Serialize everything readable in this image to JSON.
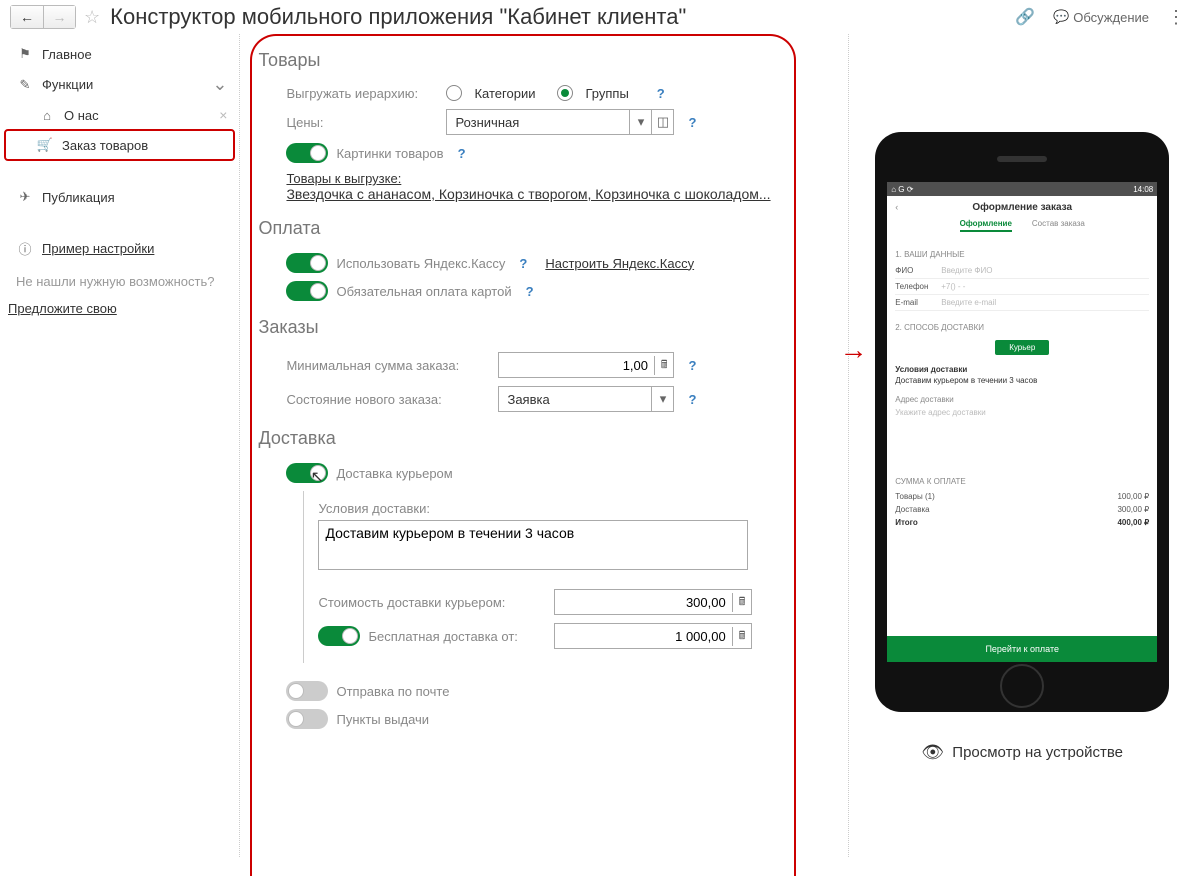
{
  "header": {
    "title": "Конструктор мобильного приложения \"Кабинет клиента\"",
    "discuss": "Обсуждение"
  },
  "sidebar": {
    "main": "Главное",
    "functions": "Функции",
    "about": "О нас",
    "order_goods": "Заказ товаров",
    "publication": "Публикация",
    "example": "Пример настройки",
    "note1": "Не нашли нужную возможность?",
    "suggest": "Предложите свою"
  },
  "goods": {
    "title": "Товары",
    "hierarchy_label": "Выгружать иерархию:",
    "opt_categories": "Категории",
    "opt_groups": "Группы",
    "prices_label": "Цены:",
    "price_value": "Розничная",
    "pictures_label": "Картинки товаров",
    "export_label": "Товары к выгрузке:",
    "export_list": "Звездочка с ананасом, Корзиночка с творогом, Корзиночка с шоколадом..."
  },
  "payment": {
    "title": "Оплата",
    "yandex_label": "Использовать Яндекс.Кассу",
    "yandex_setup": "Настроить Яндекс.Кассу",
    "card_label": "Обязательная оплата картой"
  },
  "orders": {
    "title": "Заказы",
    "min_sum_label": "Минимальная сумма заказа:",
    "min_sum_value": "1,00",
    "state_label": "Состояние нового заказа:",
    "state_value": "Заявка"
  },
  "delivery": {
    "title": "Доставка",
    "courier_label": "Доставка курьером",
    "conditions_label": "Условия доставки:",
    "conditions_value": "Доставим курьером в течении 3 часов",
    "cost_label": "Стоимость доставки курьером:",
    "cost_value": "300,00",
    "free_label": "Бесплатная доставка от:",
    "free_value": "1 000,00",
    "post_label": "Отправка по почте",
    "pickup_label": "Пункты выдачи"
  },
  "phone": {
    "status_left": "⌂ G ⟳",
    "status_right": "14:08",
    "title": "Оформление заказа",
    "tab1": "Оформление",
    "tab2": "Состав заказа",
    "sect1": "1. ВАШИ ДАННЫЕ",
    "fio_k": "ФИО",
    "fio_ph": "Введите ФИО",
    "phone_k": "Телефон",
    "phone_ph": "+7() - -",
    "email_k": "E-mail",
    "email_ph": "Введите e-mail",
    "sect2": "2. СПОСОБ ДОСТАВКИ",
    "courier_btn": "Курьер",
    "cond_head": "Условия доставки",
    "cond_text": "Доставим курьером в течении 3 часов",
    "addr_head": "Адрес доставки",
    "addr_ph": "Укажите адрес доставки",
    "sum_head": "СУММА К ОПЛАТЕ",
    "sum_goods_k": "Товары (1)",
    "sum_goods_v": "100,00 ₽",
    "sum_deliv_k": "Доставка",
    "sum_deliv_v": "300,00 ₽",
    "sum_total_k": "Итого",
    "sum_total_v": "400,00 ₽",
    "pay_btn": "Перейти к оплате"
  },
  "preview_link": "Просмотр на устройстве"
}
